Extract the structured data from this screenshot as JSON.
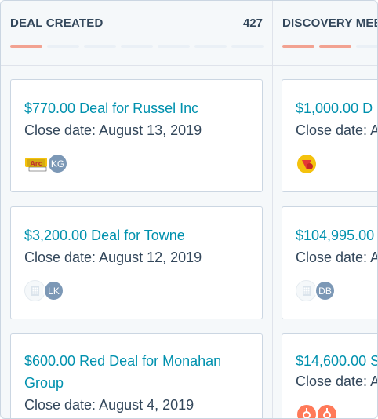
{
  "columns": [
    {
      "title": "DEAL CREATED",
      "count": "427",
      "progress": [
        true,
        false,
        false,
        false,
        false,
        false,
        false
      ],
      "cards": [
        {
          "name": "$770.00 Deal for Russel Inc",
          "close_label": "Close date:",
          "close_value": "August 13, 2019",
          "company_icon": "comics-logo-icon",
          "owner_initials": "KG"
        },
        {
          "name": "$3,200.00 Deal for Towne",
          "close_label": "Close date:",
          "close_value": "August 12, 2019",
          "company_icon": "building-icon",
          "owner_initials": "LK"
        },
        {
          "name": "$600.00 Red Deal for Monahan Group",
          "close_label": "Close date:",
          "close_value": "August 4, 2019"
        }
      ]
    },
    {
      "title": "DISCOVERY MEE",
      "progress": [
        true,
        true,
        false
      ],
      "cards": [
        {
          "name": "$1,000.00 D",
          "close_label": "Close date:",
          "close_value": "A",
          "company_icon": "stop-sign-logo-icon"
        },
        {
          "name": "$104,995.00",
          "close_label": "Close date:",
          "close_value": "A",
          "company_icon": "building-icon",
          "owner_initials": "DB"
        },
        {
          "name": "$14,600.00 S",
          "close_label": "Close date:",
          "close_value": "A",
          "company_icon": "hubspot-sprocket-icon"
        }
      ]
    }
  ],
  "colors": {
    "deal_link": "#0091ae",
    "text": "#33475b",
    "progress_on": "#f2a291",
    "progress_off": "#eaf0f6",
    "avatar_bg": "#7c98b6"
  }
}
